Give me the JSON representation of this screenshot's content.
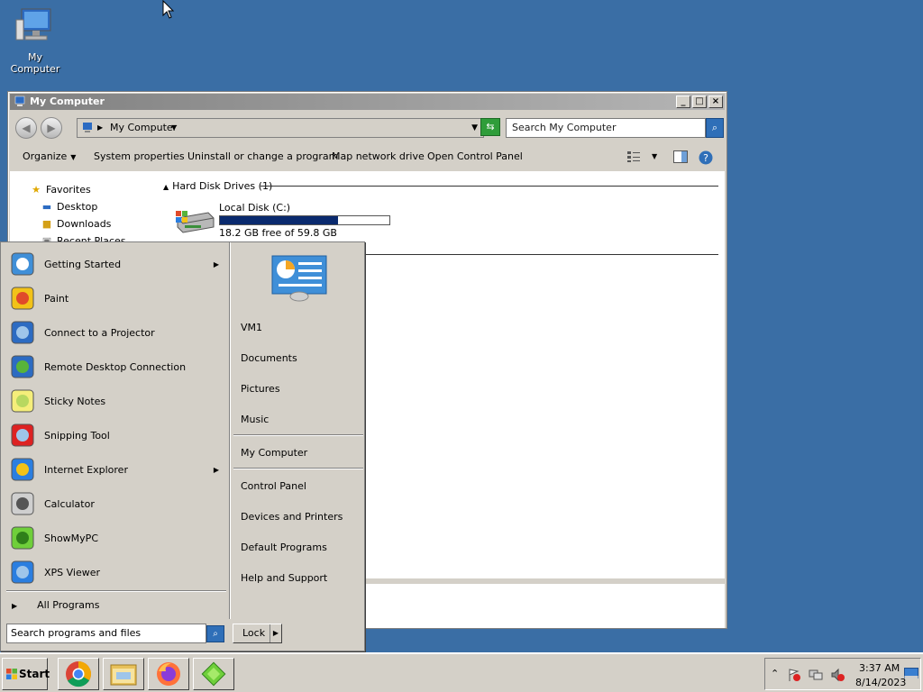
{
  "desktop": {
    "icons": [
      {
        "label": "My Computer",
        "icon": "computer-icon"
      }
    ]
  },
  "explorer": {
    "title": "My Computer",
    "address": {
      "location": "My Computer"
    },
    "search_placeholder": "Search My Computer",
    "commands": {
      "organize": "Organize",
      "system_properties": "System properties",
      "uninstall": "Uninstall or change a program",
      "map_drive": "Map network drive",
      "control_panel": "Open Control Panel"
    },
    "nav": {
      "favorites": "Favorites",
      "items": [
        "Desktop",
        "Downloads",
        "Recent Places"
      ]
    },
    "group_header": "Hard Disk Drives (1)",
    "drive": {
      "name": "Local Disk (C:)",
      "free_text": "18.2 GB free of 59.8 GB",
      "used_fraction": 0.696
    }
  },
  "start_menu": {
    "programs": [
      {
        "label": "Getting Started",
        "icon": "getting-started-icon",
        "submenu": true
      },
      {
        "label": "Paint",
        "icon": "paint-icon",
        "submenu": false
      },
      {
        "label": "Connect to a Projector",
        "icon": "projector-icon",
        "submenu": false
      },
      {
        "label": "Remote Desktop Connection",
        "icon": "remote-desktop-icon",
        "submenu": false
      },
      {
        "label": "Sticky Notes",
        "icon": "sticky-notes-icon",
        "submenu": false
      },
      {
        "label": "Snipping Tool",
        "icon": "snipping-tool-icon",
        "submenu": false
      },
      {
        "label": "Internet Explorer",
        "icon": "internet-explorer-icon",
        "submenu": true
      },
      {
        "label": "Calculator",
        "icon": "calculator-icon",
        "submenu": false
      },
      {
        "label": "ShowMyPC",
        "icon": "showmypc-icon",
        "submenu": false
      },
      {
        "label": "XPS Viewer",
        "icon": "xps-viewer-icon",
        "submenu": false
      }
    ],
    "all_programs": "All Programs",
    "right_items": {
      "user": "VM1",
      "documents": "Documents",
      "pictures": "Pictures",
      "music": "Music",
      "my_computer": "My Computer",
      "control_panel": "Control Panel",
      "devices": "Devices and Printers",
      "default_programs": "Default Programs",
      "help": "Help and Support"
    },
    "search_placeholder": "Search programs and files",
    "lock_label": "Lock"
  },
  "taskbar": {
    "start_label": "Start",
    "apps": [
      "chrome-icon",
      "file-explorer-icon",
      "firefox-icon",
      "showmypc-icon"
    ],
    "clock": {
      "time": "3:37 AM",
      "date": "8/14/2023"
    }
  }
}
